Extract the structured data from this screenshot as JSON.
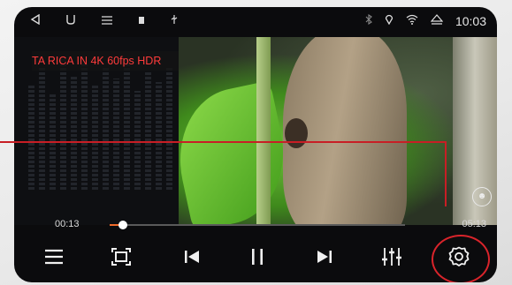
{
  "status_bar": {
    "icons": [
      "back-icon",
      "home-icon",
      "menu-icon",
      "sd-card-icon",
      "usb-icon",
      "bluetooth-icon",
      "location-icon",
      "wifi-icon",
      "eject-icon"
    ],
    "time": "10:03"
  },
  "video": {
    "title_overlay": "TA RICA IN 4K 60fps HDR"
  },
  "progress": {
    "current_time": "00:13",
    "duration": "05:13",
    "fraction": 0.045
  },
  "controls": [
    "playlist-icon",
    "aspect-ratio-icon",
    "previous-icon",
    "pause-icon",
    "next-icon",
    "equalizer-icon",
    "settings-icon"
  ],
  "colors": {
    "accent": "#f06a2a",
    "highlight": "#d9242b",
    "overlay_text": "#ff3b3b"
  }
}
